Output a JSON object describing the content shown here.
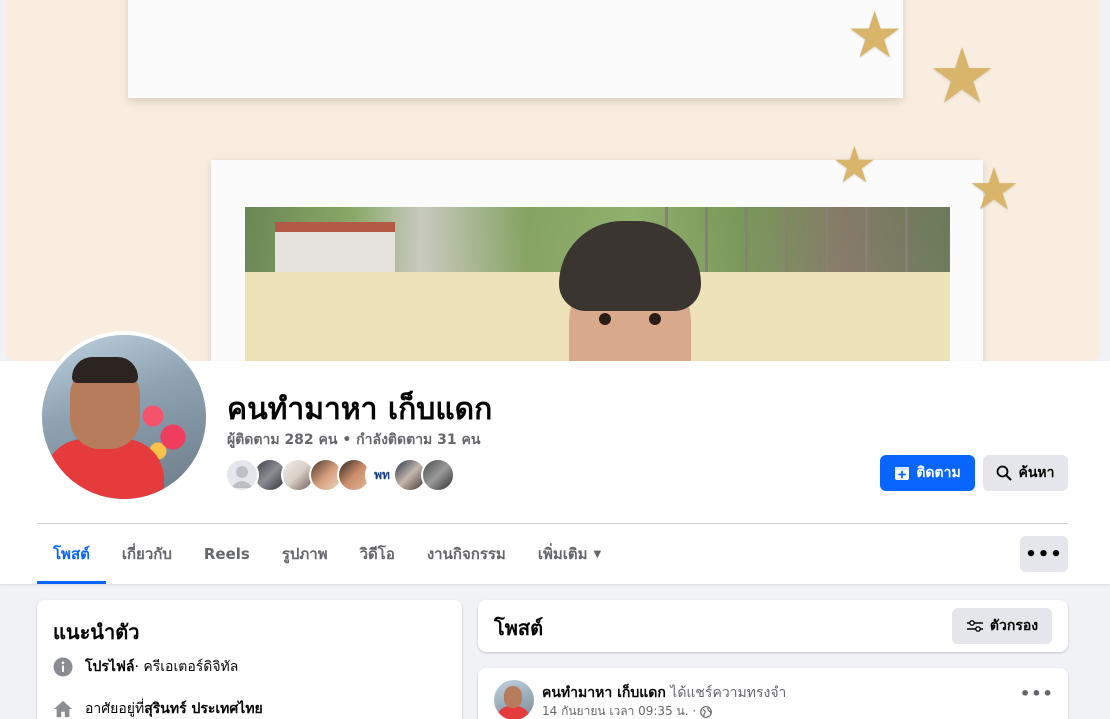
{
  "profile": {
    "name": "คนทำมาหา เก็บแดก",
    "followers_text": "ผู้ติดตาม 282 คน • กำลังติดตาม 31 คน"
  },
  "actions": {
    "follow_label": "ติดตาม",
    "search_label": "ค้นหา",
    "more_label": "•••"
  },
  "tabs": [
    {
      "label": "โพสต์"
    },
    {
      "label": "เกี่ยวกับ"
    },
    {
      "label": "Reels"
    },
    {
      "label": "รูปภาพ"
    },
    {
      "label": "วิดีโอ"
    },
    {
      "label": "งานกิจกรรม"
    },
    {
      "label": "เพิ่มเติม"
    }
  ],
  "intro": {
    "title": "แนะนำตัว",
    "profile_label": "โปรไฟล์",
    "profile_value": " · ครีเอเตอร์ดิจิทัล",
    "lives_prefix": "อาศัยอยู่ที่ ",
    "lives_value": "สุรินทร์ ประเทศไทย"
  },
  "posts_section": {
    "title": "โพสต์",
    "filter_label": "ตัวกรอง"
  },
  "post": {
    "author": "คนทำมาหา เก็บแดก",
    "action": " ได้แชร์ความทรงจำ",
    "timestamp": "14 กันยายน เวลา 09:35 น. ·",
    "more_label": "•••"
  },
  "colors": {
    "accent": "#0866ff",
    "page_bg": "#f0f2f5",
    "cover_bg": "#f9eddf"
  }
}
